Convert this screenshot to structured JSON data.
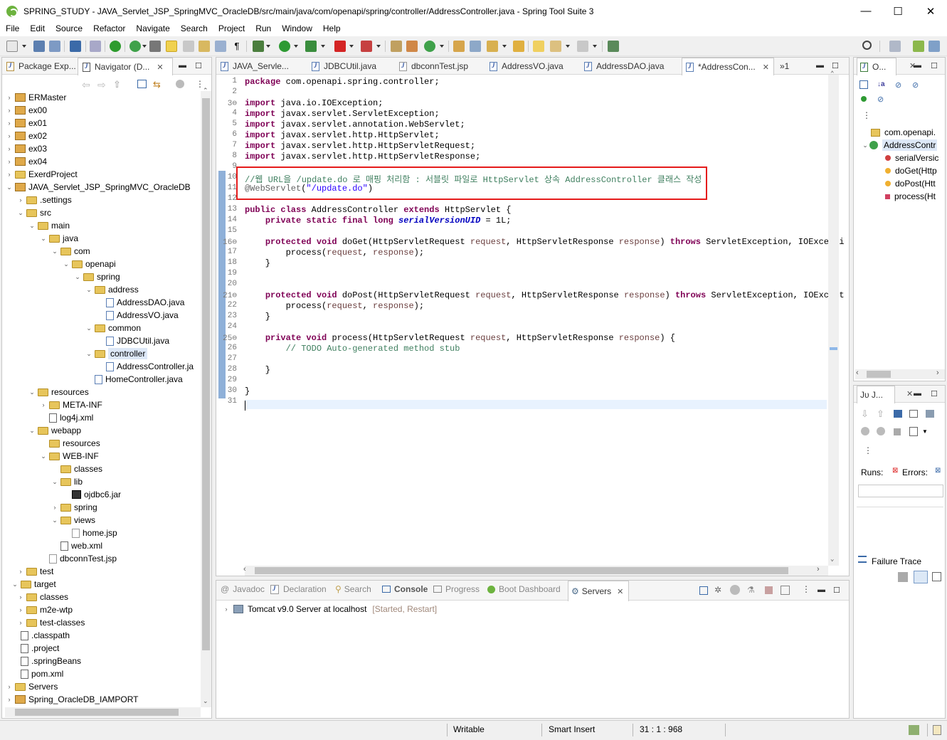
{
  "window": {
    "title": "SPRING_STUDY - JAVA_Servlet_JSP_SpringMVC_OracleDB/src/main/java/com/openapi/spring/controller/AddressController.java - Spring Tool Suite 3"
  },
  "menu": [
    "File",
    "Edit",
    "Source",
    "Refactor",
    "Navigate",
    "Search",
    "Project",
    "Run",
    "Window",
    "Help"
  ],
  "left_panel": {
    "tabs": [
      {
        "label": "Package Exp..."
      },
      {
        "label": "Navigator (D..."
      }
    ],
    "tree": [
      {
        "label": "ERMaster",
        "depth": 0,
        "tw": "›",
        "icon": "project"
      },
      {
        "label": "ex00",
        "depth": 0,
        "tw": "›",
        "icon": "project"
      },
      {
        "label": "ex01",
        "depth": 0,
        "tw": "›",
        "icon": "project"
      },
      {
        "label": "ex02",
        "depth": 0,
        "tw": "›",
        "icon": "project"
      },
      {
        "label": "ex03",
        "depth": 0,
        "tw": "›",
        "icon": "project"
      },
      {
        "label": "ex04",
        "depth": 0,
        "tw": "›",
        "icon": "project"
      },
      {
        "label": "ExerdProject",
        "depth": 0,
        "tw": "›",
        "icon": "folder"
      },
      {
        "label": "JAVA_Servlet_JSP_SpringMVC_OracleDB",
        "depth": 0,
        "tw": "⌄",
        "icon": "project"
      },
      {
        "label": ".settings",
        "depth": 1,
        "tw": "›",
        "icon": "folder"
      },
      {
        "label": "src",
        "depth": 1,
        "tw": "⌄",
        "icon": "folder"
      },
      {
        "label": "main",
        "depth": 2,
        "tw": "⌄",
        "icon": "folder"
      },
      {
        "label": "java",
        "depth": 3,
        "tw": "⌄",
        "icon": "folder"
      },
      {
        "label": "com",
        "depth": 4,
        "tw": "⌄",
        "icon": "folder"
      },
      {
        "label": "openapi",
        "depth": 5,
        "tw": "⌄",
        "icon": "folder"
      },
      {
        "label": "spring",
        "depth": 6,
        "tw": "⌄",
        "icon": "folder"
      },
      {
        "label": "address",
        "depth": 7,
        "tw": "⌄",
        "icon": "folder"
      },
      {
        "label": "AddressDAO.java",
        "depth": 8,
        "tw": "",
        "icon": "file"
      },
      {
        "label": "AddressVO.java",
        "depth": 8,
        "tw": "",
        "icon": "file"
      },
      {
        "label": "common",
        "depth": 7,
        "tw": "⌄",
        "icon": "folder"
      },
      {
        "label": "JDBCUtil.java",
        "depth": 8,
        "tw": "",
        "icon": "file"
      },
      {
        "label": "controller",
        "depth": 7,
        "tw": "⌄",
        "icon": "folder",
        "selected": true
      },
      {
        "label": "AddressController.ja",
        "depth": 8,
        "tw": "",
        "icon": "file"
      },
      {
        "label": "HomeController.java",
        "depth": 7,
        "tw": "",
        "icon": "file"
      },
      {
        "label": "resources",
        "depth": 2,
        "tw": "⌄",
        "icon": "folder"
      },
      {
        "label": "META-INF",
        "depth": 3,
        "tw": "›",
        "icon": "folder"
      },
      {
        "label": "log4j.xml",
        "depth": 3,
        "tw": "",
        "icon": "xml"
      },
      {
        "label": "webapp",
        "depth": 2,
        "tw": "⌄",
        "icon": "folder"
      },
      {
        "label": "resources",
        "depth": 3,
        "tw": "",
        "icon": "folder"
      },
      {
        "label": "WEB-INF",
        "depth": 3,
        "tw": "⌄",
        "icon": "folder"
      },
      {
        "label": "classes",
        "depth": 4,
        "tw": "",
        "icon": "folder"
      },
      {
        "label": "lib",
        "depth": 4,
        "tw": "⌄",
        "icon": "folder"
      },
      {
        "label": "ojdbc6.jar",
        "depth": 5,
        "tw": "",
        "icon": "jar"
      },
      {
        "label": "spring",
        "depth": 4,
        "tw": "›",
        "icon": "folder"
      },
      {
        "label": "views",
        "depth": 4,
        "tw": "⌄",
        "icon": "folder"
      },
      {
        "label": "home.jsp",
        "depth": 5,
        "tw": "",
        "icon": "jsp"
      },
      {
        "label": "web.xml",
        "depth": 4,
        "tw": "",
        "icon": "xml"
      },
      {
        "label": "dbconnTest.jsp",
        "depth": 3,
        "tw": "",
        "icon": "jsp"
      },
      {
        "label": "test",
        "depth": 1,
        "tw": "›",
        "icon": "folder"
      },
      {
        "label": "target",
        "depth": 0.5,
        "tw": "⌄",
        "icon": "folder"
      },
      {
        "label": "classes",
        "depth": 1,
        "tw": "›",
        "icon": "folder"
      },
      {
        "label": "m2e-wtp",
        "depth": 1,
        "tw": "›",
        "icon": "folder"
      },
      {
        "label": "test-classes",
        "depth": 1,
        "tw": "›",
        "icon": "folder"
      },
      {
        "label": ".classpath",
        "depth": 0.5,
        "tw": "",
        "icon": "xml"
      },
      {
        "label": ".project",
        "depth": 0.5,
        "tw": "",
        "icon": "xml"
      },
      {
        "label": ".springBeans",
        "depth": 0.5,
        "tw": "",
        "icon": "xml"
      },
      {
        "label": "pom.xml",
        "depth": 0.5,
        "tw": "",
        "icon": "xml"
      },
      {
        "label": "Servers",
        "depth": 0,
        "tw": "›",
        "icon": "folder"
      },
      {
        "label": "Spring_OracleDB_IAMPORT",
        "depth": 0,
        "tw": "›",
        "icon": "project"
      }
    ]
  },
  "editor": {
    "tabs": [
      {
        "label": "JAVA_Servle..."
      },
      {
        "label": "JDBCUtil.java"
      },
      {
        "label": "dbconnTest.jsp"
      },
      {
        "label": "AddressVO.java"
      },
      {
        "label": "AddressDAO.java"
      },
      {
        "label": "*AddressCon..."
      }
    ],
    "overflow": "»1",
    "lines": [
      "1",
      "2",
      "3⊖",
      "4",
      "5",
      "6",
      "7",
      "8",
      "9",
      "10",
      "11",
      "12",
      "13",
      "14",
      "15",
      "16⊖",
      "17",
      "18",
      "19",
      "20",
      "21⊖",
      "22",
      "23",
      "24",
      "25⊖",
      "26",
      "27",
      "28",
      "29",
      "30",
      "31"
    ],
    "code": [
      [
        [
          "kw",
          "package"
        ],
        [
          "",
          "com.openapi.spring.controller;"
        ]
      ],
      [],
      [
        [
          "kw",
          "import"
        ],
        [
          "",
          "java.io.IOException;"
        ]
      ],
      [
        [
          "kw",
          "import"
        ],
        [
          "",
          "javax.servlet.ServletException;"
        ]
      ],
      [
        [
          "kw",
          "import"
        ],
        [
          "",
          "javax.servlet.annotation.WebServlet;"
        ]
      ],
      [
        [
          "kw",
          "import"
        ],
        [
          "",
          "javax.servlet.http.HttpServlet;"
        ]
      ],
      [
        [
          "kw",
          "import"
        ],
        [
          "",
          "javax.servlet.http.HttpServletRequest;"
        ]
      ],
      [
        [
          "kw",
          "import"
        ],
        [
          "",
          "javax.servlet.http.HttpServletResponse;"
        ]
      ],
      [],
      [
        [
          "cm",
          "//웹 URL을 /update.do 로 매핑 처리함 : 서블릿 파일로 HttpServlet 상속 AddressController 클래스 작성"
        ]
      ],
      [
        [
          "ann",
          "@WebServlet"
        ],
        [
          "",
          "("
        ],
        [
          "str",
          "\"/update.do\""
        ],
        [
          "",
          ")"
        ]
      ],
      [],
      [
        [
          "kw",
          "public class"
        ],
        [
          "",
          "AddressController "
        ],
        [
          "kw",
          "extends"
        ],
        [
          "",
          "HttpServlet {"
        ]
      ],
      [
        [
          "",
          "    "
        ],
        [
          "kw",
          "private static final long"
        ],
        [
          "fld",
          "serialVersionUID"
        ],
        [
          "",
          " = 1L;"
        ]
      ],
      [],
      [
        [
          "",
          "    "
        ],
        [
          "kw",
          "protected void"
        ],
        [
          "",
          "doGet(HttpServletRequest "
        ],
        [
          "par",
          "request"
        ],
        [
          "",
          ", HttpServletResponse "
        ],
        [
          "par",
          "response"
        ],
        [
          "",
          ") "
        ],
        [
          "kw",
          "throws"
        ],
        [
          "",
          "ServletException, IOExcepti"
        ]
      ],
      [
        [
          "",
          "        process("
        ],
        [
          "par",
          "request"
        ],
        [
          "",
          ", "
        ],
        [
          "par",
          "response"
        ],
        [
          "",
          ");"
        ]
      ],
      [
        [
          "",
          "    }"
        ]
      ],
      [],
      [],
      [
        [
          "",
          "    "
        ],
        [
          "kw",
          "protected void"
        ],
        [
          "",
          "doPost(HttpServletRequest "
        ],
        [
          "par",
          "request"
        ],
        [
          "",
          ", HttpServletResponse "
        ],
        [
          "par",
          "response"
        ],
        [
          "",
          ") "
        ],
        [
          "kw",
          "throws"
        ],
        [
          "",
          "ServletException, IOExcept"
        ]
      ],
      [
        [
          "",
          "        process("
        ],
        [
          "par",
          "request"
        ],
        [
          "",
          ", "
        ],
        [
          "par",
          "response"
        ],
        [
          "",
          ");"
        ]
      ],
      [
        [
          "",
          "    }"
        ]
      ],
      [],
      [
        [
          "",
          "    "
        ],
        [
          "kw",
          "private void"
        ],
        [
          "",
          "process(HttpServletRequest "
        ],
        [
          "par",
          "request"
        ],
        [
          "",
          ", HttpServletResponse "
        ],
        [
          "par",
          "response"
        ],
        [
          "",
          ") {"
        ]
      ],
      [
        [
          "cm",
          "        // TODO Auto-generated method stub"
        ]
      ],
      [],
      [
        [
          "",
          "    }"
        ]
      ],
      [],
      [
        [
          "",
          "}"
        ]
      ],
      []
    ]
  },
  "outline": {
    "tab_label": "O...",
    "items": [
      {
        "label": "com.openapi.",
        "icon": "pkg"
      },
      {
        "label": "AddressContr",
        "icon": "class",
        "selected": true
      },
      {
        "label": "serialVersic",
        "icon": "field"
      },
      {
        "label": "doGet(Http",
        "icon": "method"
      },
      {
        "label": "doPost(Htt",
        "icon": "method"
      },
      {
        "label": "process(Ht",
        "icon": "private"
      }
    ]
  },
  "junit": {
    "tab_label": "Jᴜ J...",
    "runs_label": "Runs:",
    "errors_label": "Errors:",
    "failure_trace": "Failure Trace"
  },
  "bottom": {
    "tabs": [
      {
        "label": "Javadoc"
      },
      {
        "label": "Declaration"
      },
      {
        "label": "Search"
      },
      {
        "label": "Console"
      },
      {
        "label": "Progress"
      },
      {
        "label": "Boot Dashboard"
      },
      {
        "label": "Servers"
      }
    ],
    "server": {
      "name": "Tomcat v9.0 Server at localhost",
      "state": "[Started, Restart]"
    }
  },
  "statusbar": {
    "writable": "Writable",
    "insert": "Smart Insert",
    "position": "31 : 1 : 968"
  },
  "colors": {
    "highlight_box": "#e51b1b",
    "selection": "#dde8f7"
  }
}
